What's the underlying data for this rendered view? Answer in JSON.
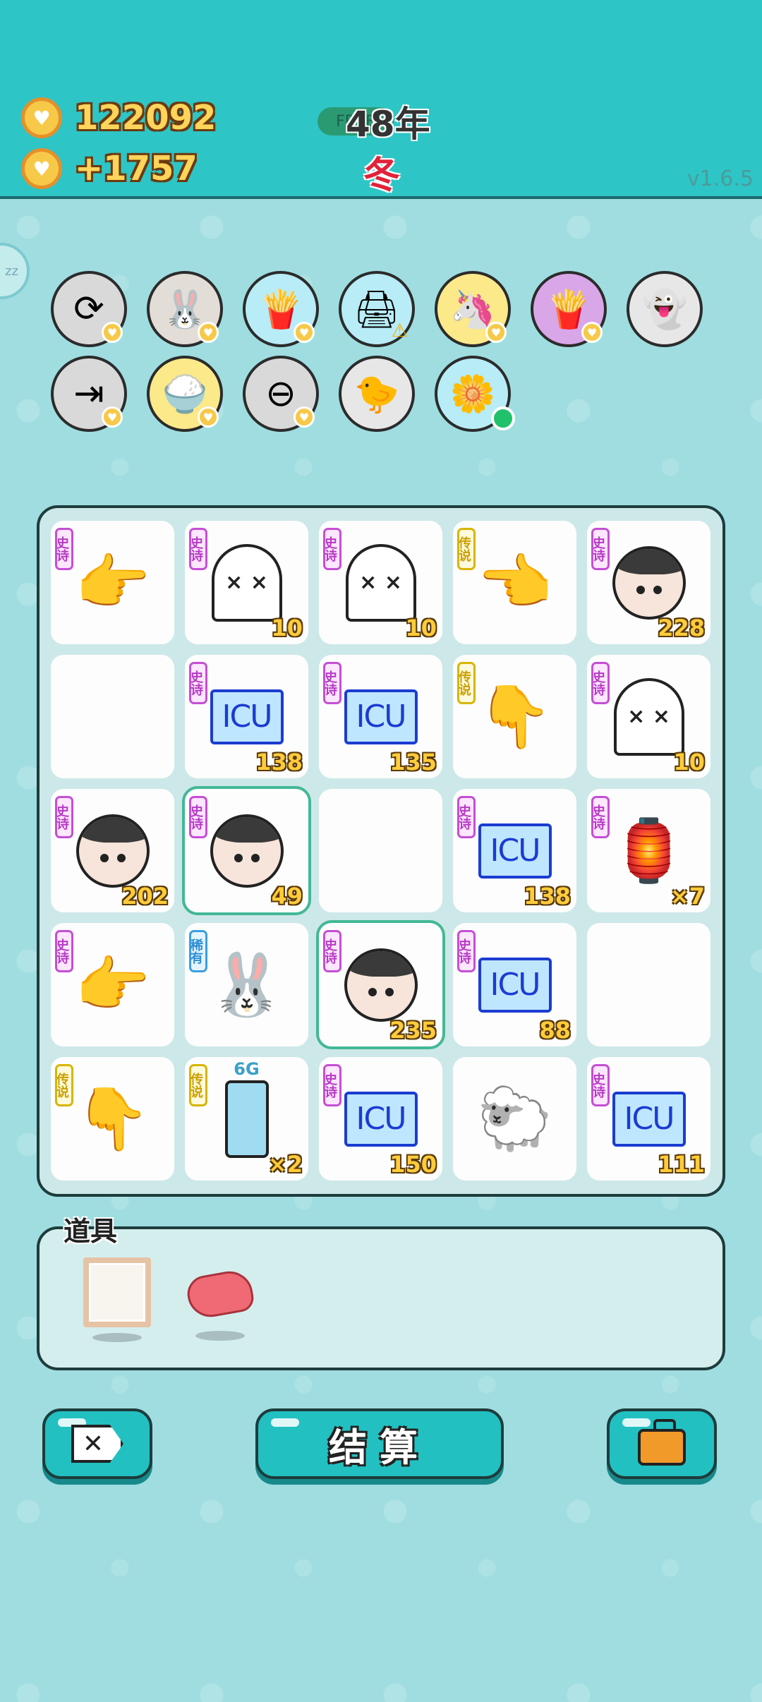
{
  "header": {
    "coins": "122092",
    "income": "+1757",
    "year_pill": "FREE",
    "year": "48年",
    "season": "冬",
    "version": "v1.6.5",
    "coin_icon": "heart-coin-icon"
  },
  "side_bubble": {
    "label": "zz"
  },
  "active_items": {
    "row1": [
      {
        "name": "refresh-icon",
        "glyph": "⟳",
        "bg": "#d9d9d9"
      },
      {
        "name": "rabbit-icon",
        "glyph": "🐰",
        "bg": "#e2ddd6"
      },
      {
        "name": "fries-icon",
        "glyph": "🍟",
        "bg": "#b8ecf6"
      },
      {
        "name": "printer-icon",
        "glyph": "🖨",
        "bg": "#b8ecf6"
      },
      {
        "name": "unicorn-icon",
        "glyph": "🦄",
        "bg": "#fbe98a"
      },
      {
        "name": "fries-purple-icon",
        "glyph": "🍟",
        "bg": "#d9a6e8"
      },
      {
        "name": "ghost-tongue-icon",
        "glyph": "👻",
        "bg": "#e7e7e7"
      }
    ],
    "row2": [
      {
        "name": "skip-icon",
        "glyph": "⇥",
        "bg": "#d9d9d9"
      },
      {
        "name": "rice-bowl-icon",
        "glyph": "🍚",
        "bg": "#fbe98a"
      },
      {
        "name": "minus-icon",
        "glyph": "⊖",
        "bg": "#d9d9d9"
      },
      {
        "name": "pressure-cooker-icon",
        "glyph": "🐤",
        "bg": "#e7e7e7"
      },
      {
        "name": "flower-pot-icon",
        "glyph": "🌼",
        "bg": "#b8ecf6"
      }
    ]
  },
  "rarity": {
    "epic": "史诗",
    "legend": "传说",
    "rare": "稀有"
  },
  "board": {
    "rows": [
      [
        {
          "icon": "pointing-hand-gray-icon",
          "glyph": "👉",
          "tag": "史诗",
          "tag_kind": "epic",
          "count": ""
        },
        {
          "icon": "ghost-icon",
          "glyph": "× ×",
          "tag": "史诗",
          "tag_kind": "epic",
          "count": "10"
        },
        {
          "icon": "ghost-icon",
          "glyph": "× ×",
          "tag": "史诗",
          "tag_kind": "epic",
          "count": "10"
        },
        {
          "icon": "pointing-hand-yellow-icon",
          "glyph": "👈",
          "tag": "传说",
          "tag_kind": "legend",
          "count": ""
        },
        {
          "icon": "face-icon",
          "glyph": "",
          "tag": "史诗",
          "tag_kind": "epic",
          "count": "228"
        }
      ],
      [
        {
          "icon": "empty",
          "glyph": "",
          "tag": "",
          "tag_kind": "",
          "count": ""
        },
        {
          "icon": "icu-icon",
          "glyph": "ICU",
          "tag": "史诗",
          "tag_kind": "epic",
          "count": "138"
        },
        {
          "icon": "icu-icon",
          "glyph": "ICU",
          "tag": "史诗",
          "tag_kind": "epic",
          "count": "135"
        },
        {
          "icon": "pointing-hand-yellow-icon",
          "glyph": "👇",
          "tag": "传说",
          "tag_kind": "legend",
          "count": ""
        },
        {
          "icon": "ghost-icon",
          "glyph": "× ×",
          "tag": "史诗",
          "tag_kind": "epic",
          "count": "10"
        }
      ],
      [
        {
          "icon": "face-icon",
          "glyph": "",
          "tag": "史诗",
          "tag_kind": "epic",
          "count": "202"
        },
        {
          "icon": "face-icon",
          "glyph": "",
          "tag": "史诗",
          "tag_kind": "epic",
          "count": "49",
          "selected": true
        },
        {
          "icon": "empty",
          "glyph": "",
          "tag": "",
          "tag_kind": "",
          "count": ""
        },
        {
          "icon": "icu-icon",
          "glyph": "ICU",
          "tag": "史诗",
          "tag_kind": "epic",
          "count": "138"
        },
        {
          "icon": "rabbit-house-icon",
          "glyph": "🏮",
          "tag": "史诗",
          "tag_kind": "epic",
          "count": "×7"
        }
      ],
      [
        {
          "icon": "pointing-hand-gray-icon",
          "glyph": "👉",
          "tag": "史诗",
          "tag_kind": "epic",
          "count": ""
        },
        {
          "icon": "rabbit-icon",
          "glyph": "🐰",
          "tag": "稀有",
          "tag_kind": "rare",
          "count": ""
        },
        {
          "icon": "face-icon",
          "glyph": "",
          "tag": "史诗",
          "tag_kind": "epic",
          "count": "235",
          "selected": true
        },
        {
          "icon": "icu-icon",
          "glyph": "ICU",
          "tag": "史诗",
          "tag_kind": "epic",
          "count": "88"
        },
        {
          "icon": "empty",
          "glyph": "",
          "tag": "",
          "tag_kind": "",
          "count": ""
        }
      ],
      [
        {
          "icon": "pointing-hand-yellow-icon",
          "glyph": "👇",
          "tag": "传说",
          "tag_kind": "legend",
          "count": ""
        },
        {
          "icon": "fridge-icon",
          "glyph": "6G",
          "tag": "传说",
          "tag_kind": "legend",
          "count": "×2"
        },
        {
          "icon": "icu-icon",
          "glyph": "ICU",
          "tag": "史诗",
          "tag_kind": "epic",
          "count": "150"
        },
        {
          "icon": "sheep-icon",
          "glyph": "🐑",
          "tag": "",
          "tag_kind": "",
          "count": ""
        },
        {
          "icon": "icu-icon",
          "glyph": "ICU",
          "tag": "史诗",
          "tag_kind": "epic",
          "count": "111"
        }
      ]
    ]
  },
  "items_panel": {
    "title": "道具",
    "items": [
      {
        "name": "frame-icon"
      },
      {
        "name": "liver-icon"
      }
    ]
  },
  "buttons": {
    "close_glyph": "✕",
    "settle_label": "结算",
    "bag_icon": "briefcase-icon"
  }
}
